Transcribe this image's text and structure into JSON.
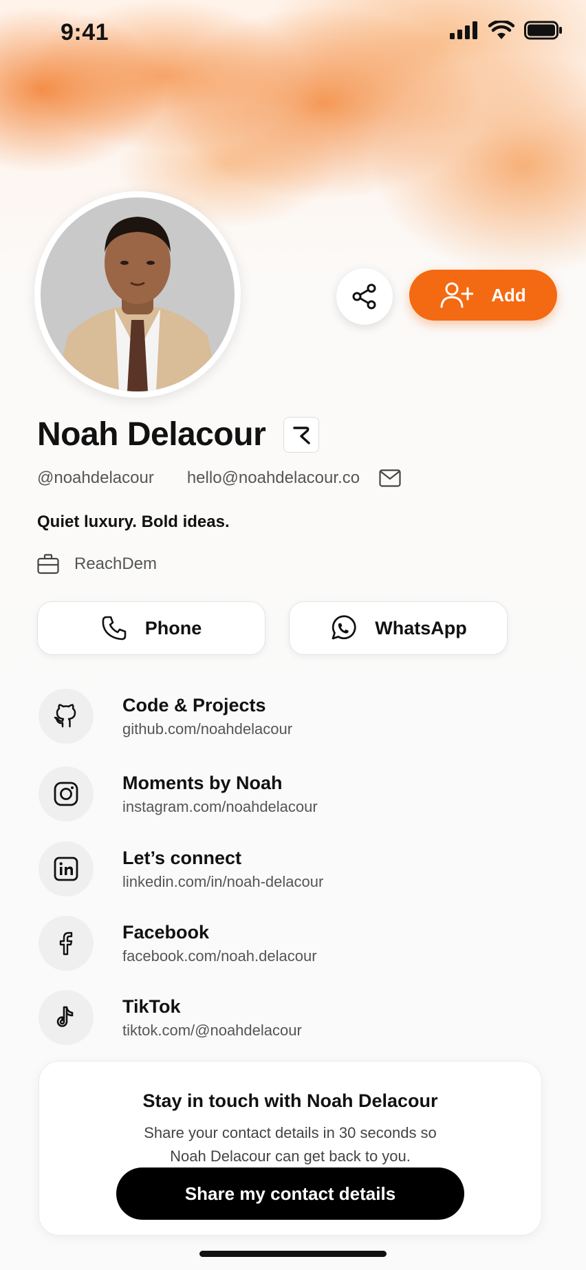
{
  "status_bar": {
    "time": "9:41"
  },
  "header": {
    "add_label": "Add"
  },
  "profile": {
    "name": "Noah Delacour",
    "handle": "@noahdelacour",
    "email": "hello@noahdelacour.co",
    "tagline": "Quiet luxury. Bold ideas.",
    "company": "ReachDem"
  },
  "actions": {
    "phone_label": "Phone",
    "whatsapp_label": "WhatsApp"
  },
  "links": [
    {
      "title": "Code & Projects",
      "url": "github.com/noahdelacour",
      "icon": "github-icon"
    },
    {
      "title": "Moments by Noah",
      "url": "instagram.com/noahdelacour",
      "icon": "instagram-icon"
    },
    {
      "title": "Let’s connect",
      "url": "linkedin.com/in/noah-delacour",
      "icon": "linkedin-icon"
    },
    {
      "title": "Facebook",
      "url": "facebook.com/noah.delacour",
      "icon": "facebook-icon"
    },
    {
      "title": "TikTok",
      "url": "tiktok.com/@noahdelacour",
      "icon": "tiktok-icon"
    }
  ],
  "contact_card": {
    "title": "Stay in touch with Noah Delacour",
    "subtitle": "Share your contact details in 30 seconds so Noah Delacour can get back to you.",
    "button_label": "Share my contact details"
  },
  "colors": {
    "accent": "#f36a12",
    "primary_button": "#000000"
  }
}
